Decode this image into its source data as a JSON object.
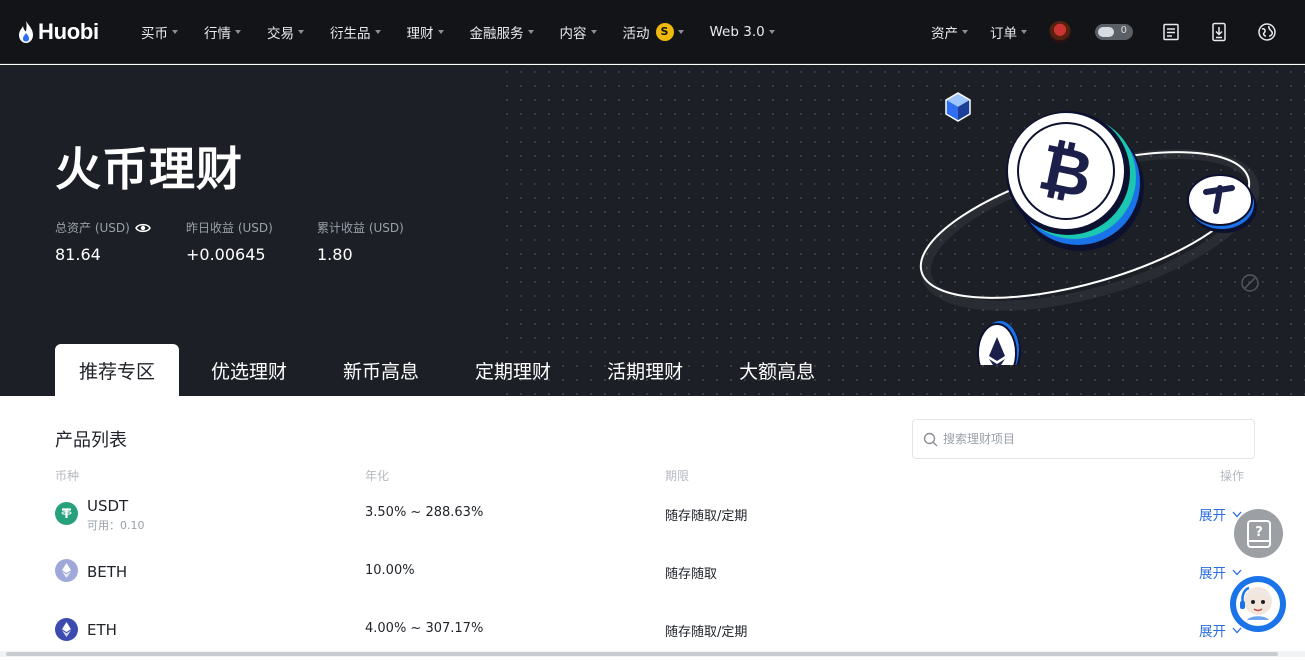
{
  "nav": {
    "logo_text": "Huobi",
    "menu": [
      {
        "label": "买币"
      },
      {
        "label": "行情"
      },
      {
        "label": "交易"
      },
      {
        "label": "衍生品"
      },
      {
        "label": "理财"
      },
      {
        "label": "金融服务"
      },
      {
        "label": "内容"
      },
      {
        "label": "活动",
        "badge": "S"
      },
      {
        "label": "Web 3.0"
      }
    ],
    "right": [
      {
        "label": "资产"
      },
      {
        "label": "订单"
      }
    ],
    "toggle_text": "0"
  },
  "hero": {
    "title": "火币理财",
    "stats": [
      {
        "label": "总资产 (USD)",
        "value": "81.64"
      },
      {
        "label": "昨日收益 (USD)",
        "value": "+0.00645"
      },
      {
        "label": "累计收益 (USD)",
        "value": "1.80"
      }
    ]
  },
  "tabs": [
    "推荐专区",
    "优选理财",
    "新币高息",
    "定期理财",
    "活期理财",
    "大额高息"
  ],
  "products": {
    "title": "产品列表",
    "search_placeholder": "搜索理财项目",
    "columns": {
      "coin": "币种",
      "apy": "年化",
      "term": "期限",
      "action": "操作"
    },
    "rows": [
      {
        "coin": "USDT",
        "sub": "可用：0.10",
        "apy": "3.50% ~ 288.63%",
        "term": "随存随取/定期",
        "action": "展开",
        "icon_color": "#26a17b"
      },
      {
        "coin": "BETH",
        "sub": "",
        "apy": "10.00%",
        "term": "随存随取",
        "action": "展开",
        "icon_color": "#9fa8d9"
      },
      {
        "coin": "ETH",
        "sub": "",
        "apy": "4.00% ~ 307.17%",
        "term": "随存随取/定期",
        "action": "展开",
        "icon_color": "#3c4bb0"
      }
    ]
  },
  "colors": {
    "accent": "#2a6de0",
    "nav_bg": "#121418",
    "hero_bg": "#1c1f26"
  }
}
